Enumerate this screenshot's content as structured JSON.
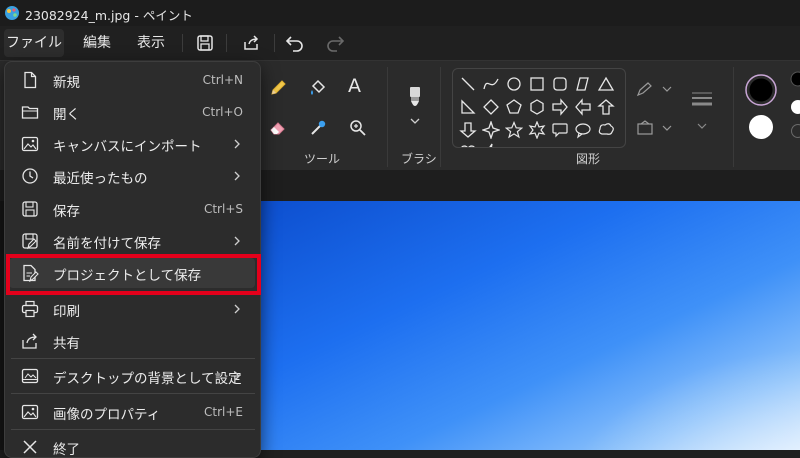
{
  "window": {
    "title": "23082924_m.jpg - ペイント"
  },
  "menubar": {
    "file": "ファイル",
    "edit": "編集",
    "view": "表示"
  },
  "ribbon": {
    "tools_label": "ツール",
    "brush_label": "ブラシ",
    "shapes_label": "図形"
  },
  "file_menu": {
    "items": [
      {
        "label": "新規",
        "shortcut": "Ctrl+N"
      },
      {
        "label": "開く",
        "shortcut": "Ctrl+O"
      },
      {
        "label": "キャンバスにインポート",
        "submenu": true
      },
      {
        "label": "最近使ったもの",
        "submenu": true
      },
      {
        "label": "保存",
        "shortcut": "Ctrl+S"
      },
      {
        "label": "名前を付けて保存",
        "submenu": true
      },
      {
        "label": "プロジェクトとして保存",
        "highlighted": true
      },
      {
        "label": "印刷",
        "submenu": true
      },
      {
        "label": "共有"
      },
      {
        "label": "デスクトップの背景として設定",
        "submenu": true
      },
      {
        "label": "画像のプロパティ",
        "shortcut": "Ctrl+E"
      },
      {
        "label": "終了"
      }
    ]
  },
  "colors": {
    "highlight_frame": "#e4001b",
    "selected_color": "#000000",
    "secondary_color": "#ffffff"
  }
}
